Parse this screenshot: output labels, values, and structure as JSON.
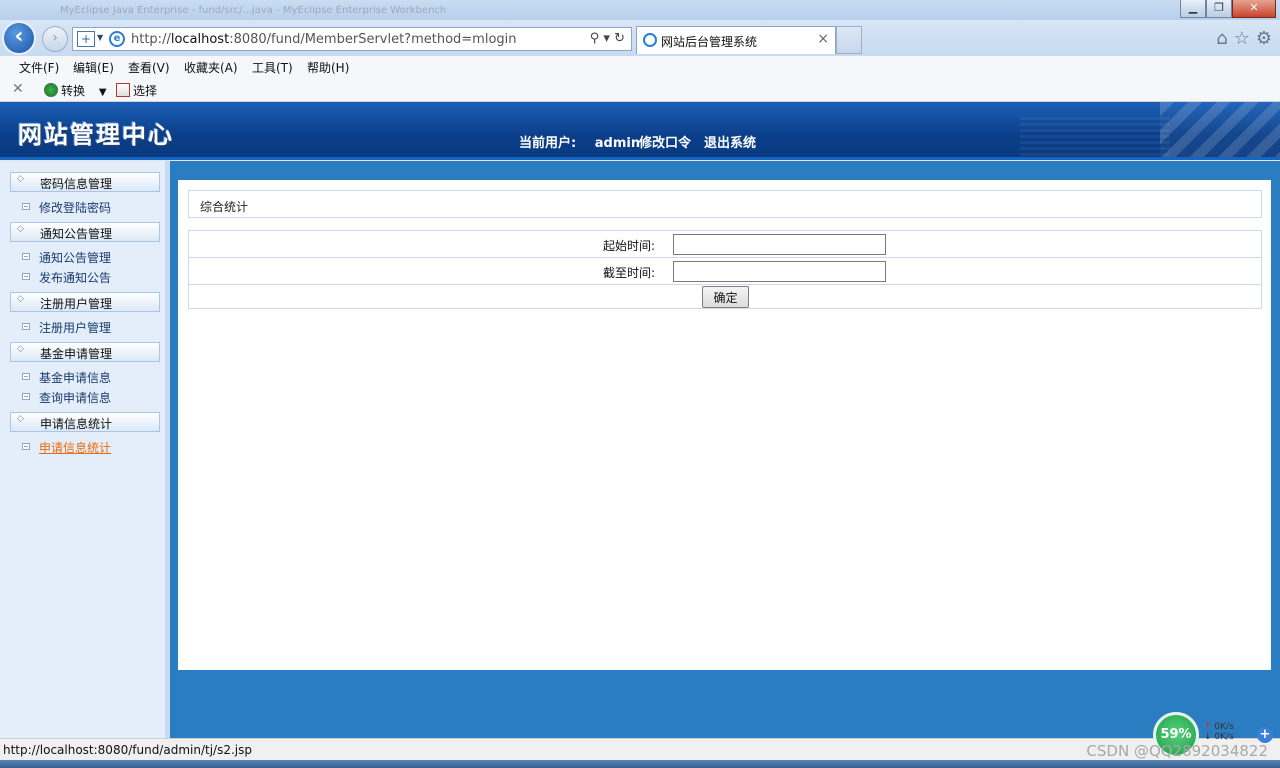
{
  "browser": {
    "title_ghost": "MyEclipse Java Enterprise - fund/src/...java - MyEclipse Enterprise Workbench",
    "url_prefix": "http://",
    "url_host": "localhost",
    "url_rest": ":8080/fund/MemberServlet?method=mlogin",
    "tab_title": "网站后台管理系统",
    "menu": [
      "文件(F)",
      "编辑(E)",
      "查看(V)",
      "收藏夹(A)",
      "工具(T)",
      "帮助(H)"
    ],
    "tools": {
      "convert": "转换",
      "select": "选择"
    }
  },
  "header": {
    "logo": "网站管理中心",
    "current_user_label": "当前用户:",
    "current_user": "admin",
    "change_password": "修改口令",
    "logout": "退出系统"
  },
  "sidebar": {
    "groups": [
      {
        "title": "密码信息管理",
        "items": [
          "修改登陆密码"
        ]
      },
      {
        "title": "通知公告管理",
        "items": [
          "通知公告管理",
          "发布通知公告"
        ]
      },
      {
        "title": "注册用户管理",
        "items": [
          "注册用户管理"
        ]
      },
      {
        "title": "基金申请管理",
        "items": [
          "基金申请信息",
          "查询申请信息"
        ]
      },
      {
        "title": "申请信息统计",
        "items": [
          "申请信息统计"
        ]
      }
    ],
    "active_item": "申请信息统计"
  },
  "main": {
    "breadcrumb": "综合统计",
    "start_time_label": "起始时间:",
    "start_time_value": "",
    "end_time_label": "截至时间:",
    "end_time_value": "",
    "submit_label": "确定"
  },
  "status": {
    "url": "http://localhost:8080/fund/admin/tj/s2.jsp",
    "watermark": "CSDN @QQ2892034822",
    "net_percent": "59%",
    "net_up": "0K/s",
    "net_down": "0K/s"
  },
  "colors": {
    "banner": "#0b3f8a",
    "content_bg": "#2a7dc0",
    "sidebar_bg": "#e4eefa",
    "active_link": "#e96b0e"
  }
}
